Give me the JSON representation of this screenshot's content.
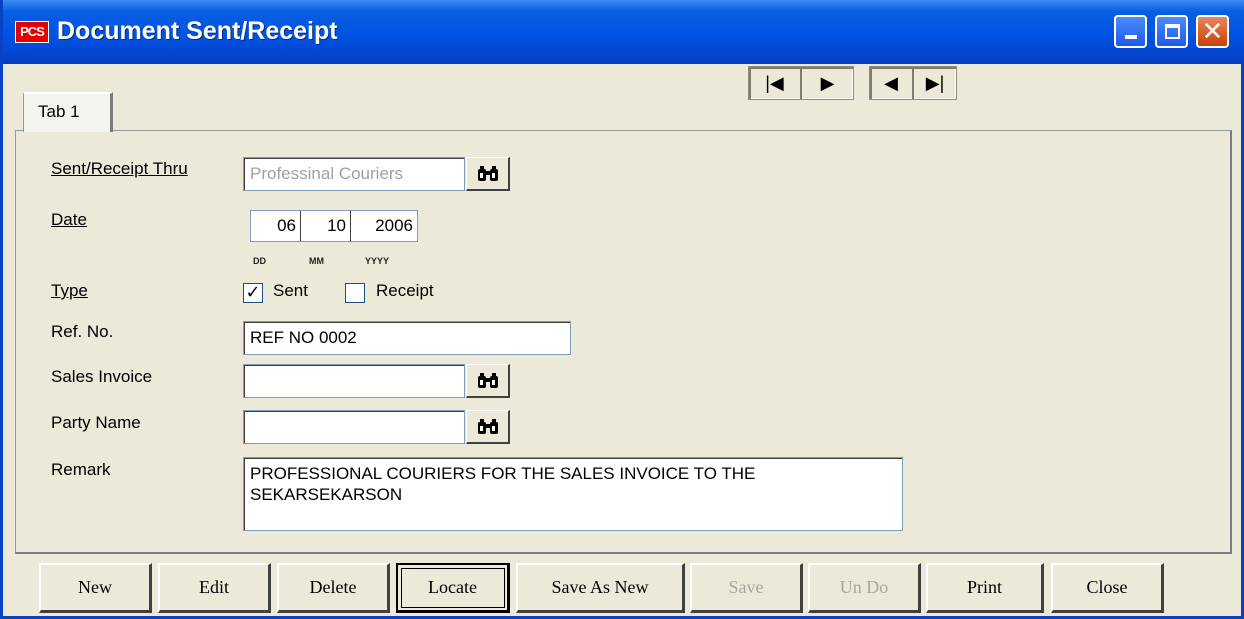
{
  "window": {
    "title": "Document Sent/Receipt",
    "app_badge": "PCS",
    "controls": [
      "minimize-icon",
      "maximize-icon",
      "close-icon"
    ]
  },
  "nav": {
    "first": "⏮",
    "next": "▶",
    "prev": "◀",
    "last": "⏭"
  },
  "tabs": [
    {
      "label": "Tab 1",
      "active": true
    }
  ],
  "form": {
    "sent_receipt_thru": {
      "label": "Sent/Receipt Thru",
      "value": "Professinal Couriers"
    },
    "date": {
      "label": "Date",
      "dd": "06",
      "mm": "10",
      "yyyy": "2006",
      "hints": [
        "DD",
        "MM",
        "YYYY"
      ]
    },
    "type": {
      "label": "Type",
      "options": [
        {
          "label": "Sent",
          "checked": true
        },
        {
          "label": "Receipt",
          "checked": false
        }
      ]
    },
    "ref_no": {
      "label": "Ref. No.",
      "value": "REF NO 0002"
    },
    "sales_invoice": {
      "label": "Sales Invoice",
      "value": ""
    },
    "party_name": {
      "label": "Party Name",
      "value": ""
    },
    "remark": {
      "label": "Remark",
      "value": "PROFESSIONAL COURIERS FOR THE SALES INVOICE TO THE SEKARSEKARSON"
    }
  },
  "buttons": {
    "new": "New",
    "edit": "Edit",
    "delete": "Delete",
    "locate": "Locate",
    "save_as_new": "Save As New",
    "save": "Save",
    "undo": "Un Do",
    "print": "Print",
    "close": "Close"
  }
}
